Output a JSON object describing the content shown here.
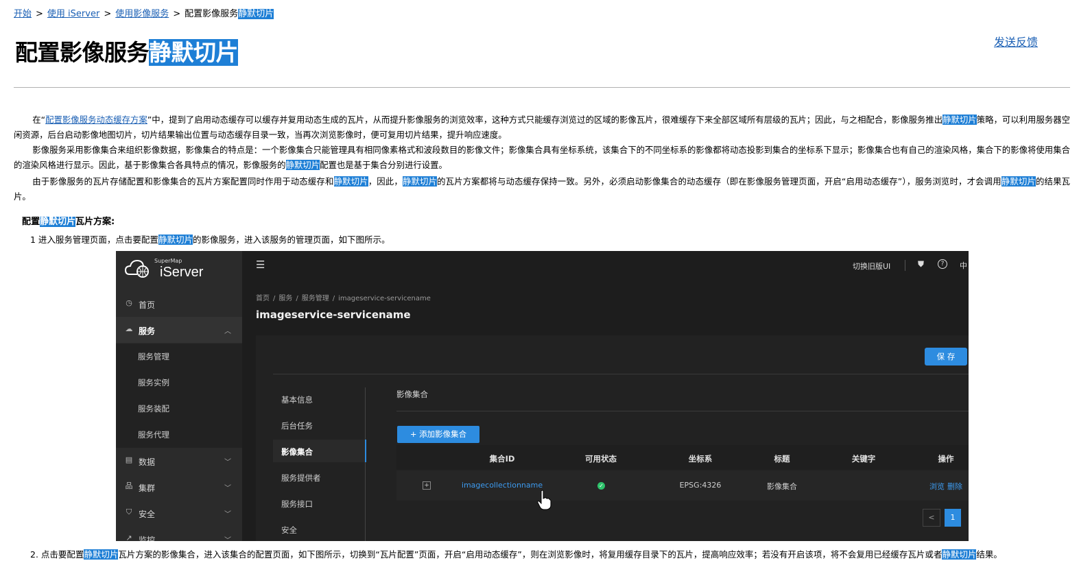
{
  "breadcrumb": {
    "start": "开始",
    "sep": ">",
    "use_iserver": "使用 iServer",
    "use_image_service": "使用影像服务",
    "current_prefix": "配置影像服务",
    "current_hl": "静默切片"
  },
  "title": {
    "prefix": "配置影像服务",
    "hl": "静默切片"
  },
  "feedback_link": "发送反馈",
  "para1": {
    "t1": "在“",
    "link": "配置影像服务动态缓存方案",
    "t2": "”中，提到了启用动态缓存可以缓存并复用动态生成的瓦片，从而提升影像服务的浏览效率，这种方式只能缓存浏览过的区域的影像瓦片，很难缓存下来全部区域所有层级的瓦片；因此，与之相配合，影像服务推出",
    "hl": "静默切片",
    "t3": "策略，可以利用服务器空闲资源，后台启动影像地图切片，切片结果输出位置与动态缓存目录一致，当再次浏览影像时，便可复用切片结果，提升响应速度。"
  },
  "para2": {
    "t1": "影像服务采用影像集合来组织影像数据，影像集合的特点是：一个影像集合只能管理具有相同像素格式和波段数目的影像文件；影像集合具有坐标系统，该集合下的不同坐标系的影像都将动态投影到集合的坐标系下显示；影像集合也有自己的渲染风格，集合下的影像将使用集合的渲染风格进行显示。因此，基于影像集合各具特点的情况，影像服务的",
    "hl": "静默切片",
    "t2": "配置也是基于集合分别进行设置。"
  },
  "para3": {
    "t1": "由于影像服务的瓦片存储配置和影像集合的瓦片方案配置同时作用于动态缓存和",
    "hl1": "静默切片",
    "t2": "，因此，",
    "hl2": "静默切片",
    "t3": "的瓦片方案都将与动态缓存保持一致。另外，必须启动影像集合的动态缓存（即在影像服务管理页面，开启“启用动态缓存”），服务浏览时，才会调用",
    "hl3": "静默切片",
    "t4": "的结果瓦片。"
  },
  "section_heading": {
    "prefix": "配置",
    "hl": "静默切片",
    "suffix": "瓦片方案:"
  },
  "step1": {
    "t1": "1 进入服务管理页面，点击要配置",
    "hl": "静默切片",
    "t2": "的影像服务，进入该服务的管理页面，如下图所示。"
  },
  "step2": {
    "t1": "2. 点击要配置",
    "hl1": "静默切片",
    "t2": "瓦片方案的影像集合，进入该集合的配置页面，如下图所示，切换到“瓦片配置”页面，开启“启用动态缓存”，则在浏览影像时，将复用缓存目录下的瓦片，提高响应效率；若没有开启该项，将不会复用已经缓存瓦片或者",
    "hl2": "静默切片",
    "t3": "结果。"
  },
  "screenshot": {
    "brand_small": "SuperMap",
    "brand_big": "iServer",
    "sidebar": {
      "home": "首页",
      "services": "服务",
      "sub": [
        "服务管理",
        "服务实例",
        "服务装配",
        "服务代理"
      ],
      "data": "数据",
      "cluster": "集群",
      "security": "安全",
      "monitor": "监控"
    },
    "topbar": {
      "switch_ui": "切换旧版UI",
      "lang": "中"
    },
    "crumbs": [
      "首页",
      "服务",
      "服务管理",
      "imageservice-servicename"
    ],
    "crumb_sep": "/",
    "service_title": "imageservice-servicename",
    "save": "保 存",
    "tabs": [
      "基本信息",
      "后台任务",
      "影像集合",
      "服务提供者",
      "服务接口",
      "安全"
    ],
    "collection_heading": "影像集合",
    "add_collection": "+ 添加影像集合",
    "columns": [
      "集合ID",
      "可用状态",
      "坐标系",
      "标题",
      "关键字",
      "操作"
    ],
    "row": {
      "expand": "+",
      "id": "imagecollectionname",
      "crs": "EPSG:4326",
      "title": "影像集合",
      "keyword": "",
      "browse": "浏览",
      "delete": "删除"
    },
    "pager": {
      "prev": "<",
      "page": "1"
    }
  },
  "colors": {
    "highlight": "#1e7fd6",
    "link": "#1a5fb4",
    "accent": "#2d8ce0",
    "panel_bg": "#1d1d1d"
  }
}
